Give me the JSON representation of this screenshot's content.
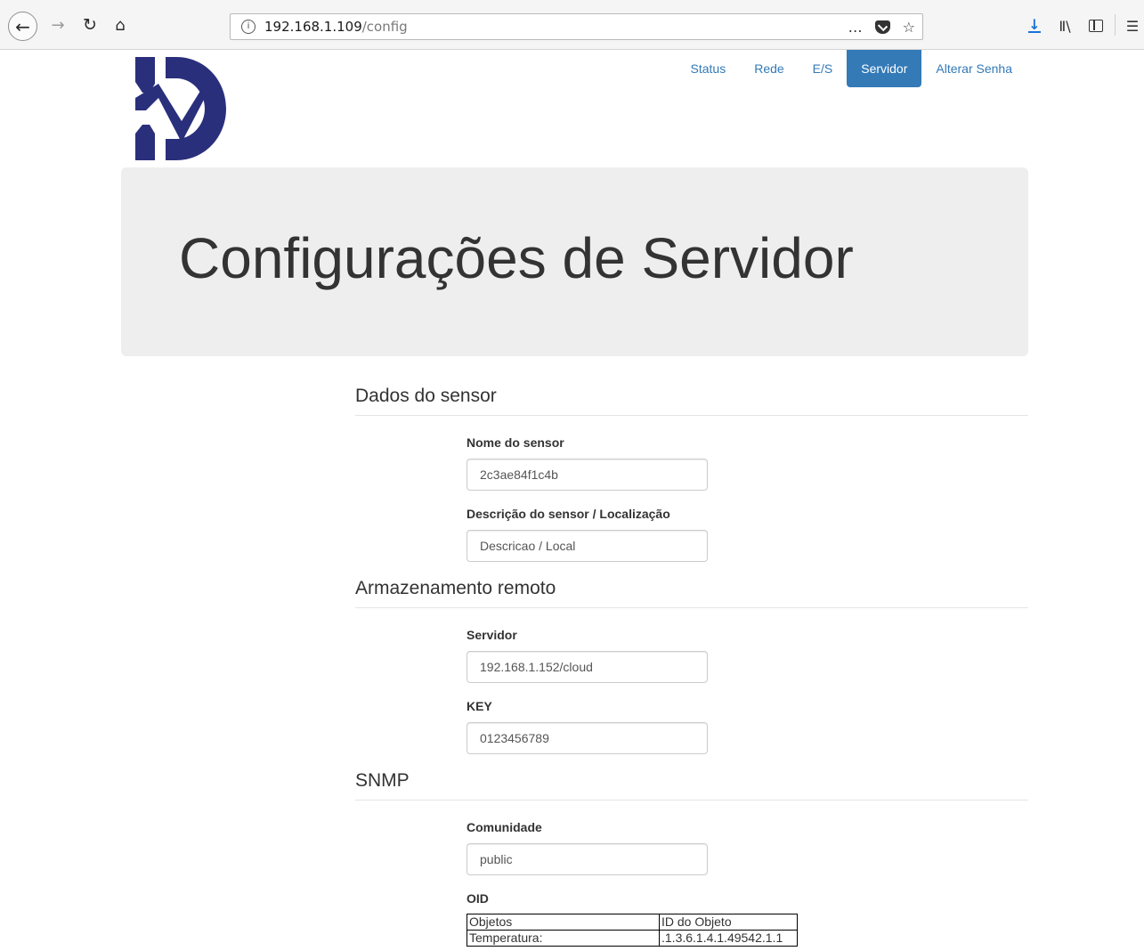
{
  "browser": {
    "url_host": "192.168.1.109",
    "url_path": "/config",
    "overflow_icon": "…",
    "icons": [
      "back-arrow-icon",
      "forward-arrow-icon",
      "reload-icon",
      "home-icon",
      "info-icon",
      "pocket-icon",
      "bookmark-star-icon",
      "download-icon",
      "library-icon",
      "sidebar-icon",
      "hamburger-menu-icon"
    ]
  },
  "brand": {
    "logo_color": "#2a2f7c"
  },
  "nav": {
    "items": [
      {
        "label": "Status"
      },
      {
        "label": "Rede"
      },
      {
        "label": "E/S"
      },
      {
        "label": "Servidor",
        "active": true
      },
      {
        "label": "Alterar Senha"
      }
    ],
    "accent": "#337ab7"
  },
  "header": {
    "title": "Configurações de Servidor"
  },
  "sections": {
    "sensor": {
      "title": "Dados do sensor",
      "name_label": "Nome do sensor",
      "name_value": "2c3ae84f1c4b",
      "desc_label": "Descrição do sensor / Localização",
      "desc_value": "Descricao / Local"
    },
    "remote": {
      "title": "Armazenamento remoto",
      "server_label": "Servidor",
      "server_value": "192.168.1.152/cloud",
      "key_label": "KEY",
      "key_value": "0123456789"
    },
    "snmp": {
      "title": "SNMP",
      "community_label": "Comunidade",
      "community_value": "public",
      "oid_label": "OID",
      "table": {
        "headers": [
          "Objetos",
          "ID do Objeto"
        ],
        "rows": [
          [
            "Temperatura:",
            ".1.3.6.1.4.1.49542.1.1"
          ]
        ]
      }
    }
  }
}
